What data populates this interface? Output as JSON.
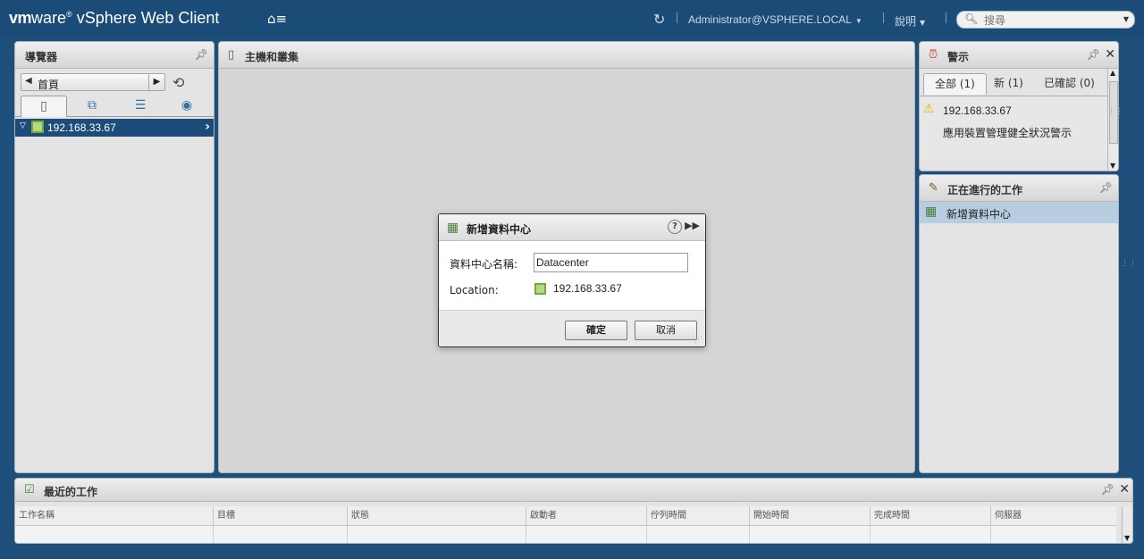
{
  "header": {
    "logo_brand": "vm",
    "logo_suffix": "ware",
    "logo_registered": "®",
    "product": "vSphere Web Client",
    "user": "Administrator@VSPHERE.LOCAL",
    "help": "說明",
    "search_placeholder": "搜尋"
  },
  "navigator": {
    "title": "導覽器",
    "breadcrumb": "首頁",
    "tree_item": "192.168.33.67"
  },
  "main": {
    "title": "主機和叢集"
  },
  "alarms": {
    "title": "警示",
    "tabs": [
      "全部 (1)",
      "新 (1)",
      "已確認 (0)"
    ],
    "items": [
      {
        "host": "192.168.33.67",
        "message": "應用裝置管理健全狀況警示"
      }
    ]
  },
  "work_in_progress": {
    "title": "正在進行的工作",
    "items": [
      "新增資料中心"
    ]
  },
  "recent_tasks": {
    "title": "最近的工作",
    "columns": [
      "工作名稱",
      "目標",
      "狀態",
      "啟動者",
      "佇列時間",
      "開始時間",
      "完成時間",
      "伺服器"
    ]
  },
  "dialog": {
    "title": "新增資料中心",
    "name_label": "資料中心名稱:",
    "name_value": "Datacenter",
    "location_label": "Location:",
    "location_value": "192.168.33.67",
    "ok": "確定",
    "cancel": "取消"
  }
}
